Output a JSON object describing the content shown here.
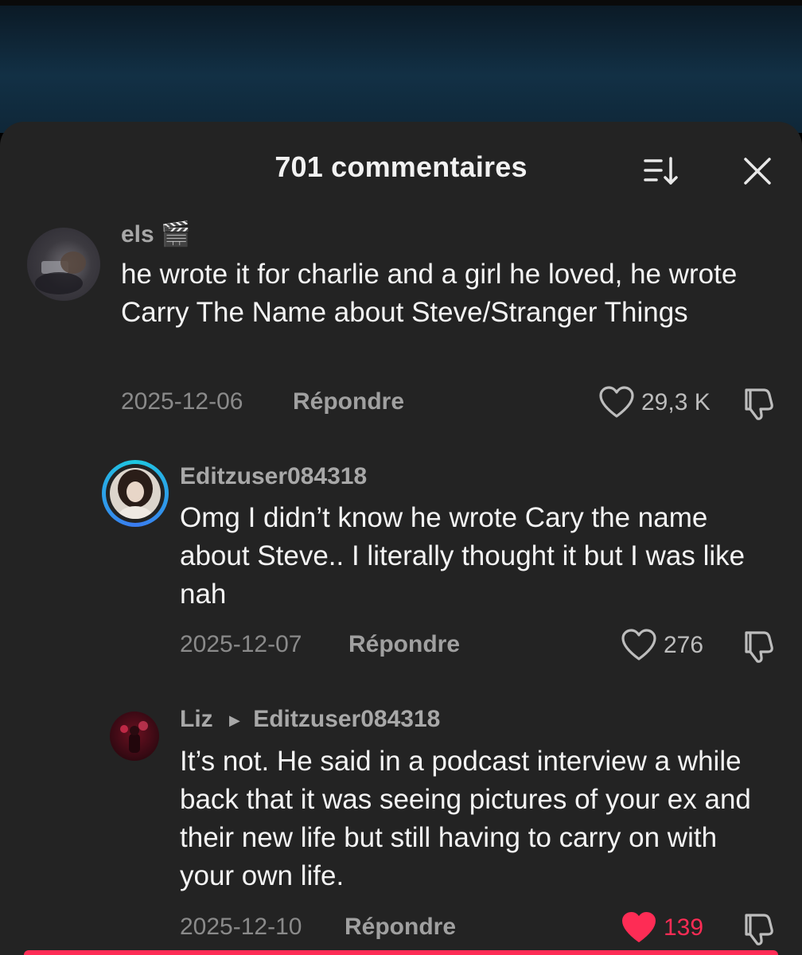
{
  "header": {
    "title": "701 commentaires"
  },
  "comments": [
    {
      "username": "els 🎬",
      "text": "he wrote it for charlie and a girl he loved, he wrote Carry The Name about Steve/Stranger Things",
      "date": "2025-12-06",
      "reply_label": "Répondre",
      "likes": "29,3 K",
      "liked": false
    },
    {
      "username": "Editzuser084318",
      "text": "Omg I didn’t know he wrote Cary the name about Steve.. I literally thought it but I was like nah",
      "date": "2025-12-07",
      "reply_label": "Répondre",
      "likes": "276",
      "liked": false
    },
    {
      "username": "Liz",
      "reply_to": "Editzuser084318",
      "text": "It’s not. He said in a podcast interview a while back that it was seeing pictures of your ex and their new life but still having to carry on with your own life.",
      "date": "2025-12-10",
      "reply_label": "Répondre",
      "likes": "139",
      "liked": true
    }
  ],
  "colors": {
    "sheet_background": "#232323",
    "accent_like": "#fe2c55",
    "story_ring": "#22b8e8"
  },
  "icons": [
    "sort-icon",
    "close-icon",
    "heart-outline-icon",
    "heart-filled-icon",
    "dislike-icon"
  ]
}
